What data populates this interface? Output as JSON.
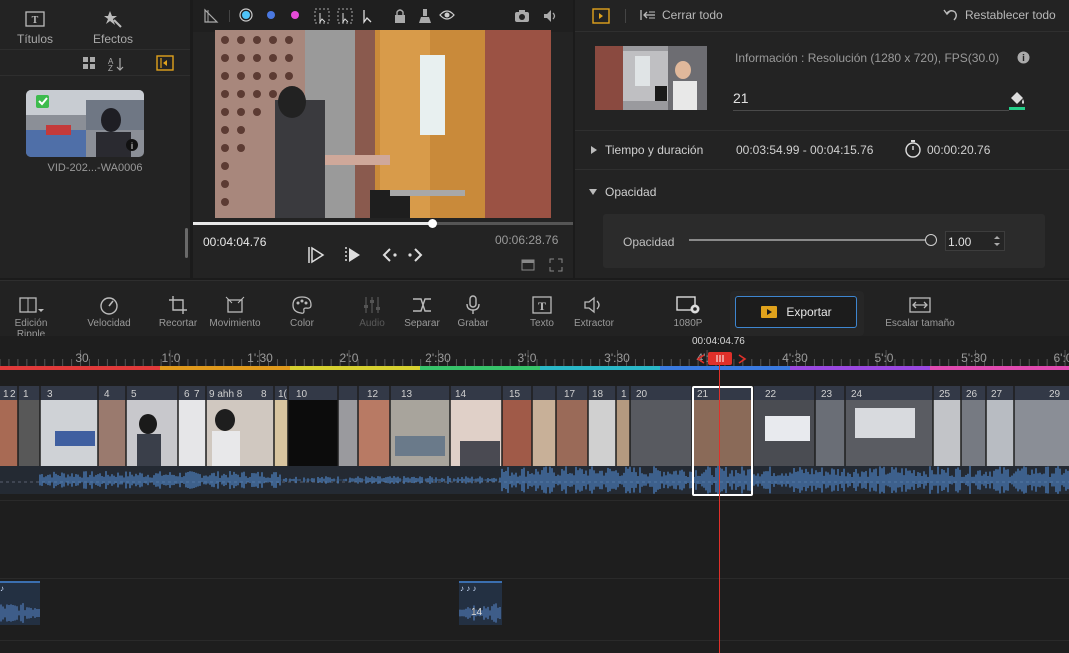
{
  "left_panel": {
    "tabs": [
      {
        "label": "Títulos",
        "icon": "titles-icon"
      },
      {
        "label": "Efectos",
        "icon": "effects-icon"
      }
    ],
    "media_item": {
      "name": "VID-202...-WA0006",
      "checked": true
    }
  },
  "preview": {
    "current_time": "00:04:04.76",
    "total_time": "00:06:28.76",
    "progress": 0.63,
    "color_dots": [
      "#4fc3f7",
      "#4a78e0",
      "#e64bd8"
    ]
  },
  "properties": {
    "close_all_label": "Cerrar todo",
    "reset_all_label": "Restablecer todo",
    "info": "Información : Resolución (1280 x 720), FPS(30.0)",
    "clip_number": "21",
    "time_section_label": "Tiempo y duración",
    "time_range": "00:03:54.99 - 00:04:15.76",
    "duration": "00:00:20.76",
    "opacity_section_label": "Opacidad",
    "opacity_label": "Opacidad",
    "opacity_value": "1.00",
    "opacity_level": 1.0
  },
  "toolbar": {
    "tools": [
      {
        "label": "Edición Ripple",
        "icon": "ripple-edit-icon"
      },
      {
        "label": "Velocidad",
        "icon": "speed-icon"
      },
      {
        "label": "Recortar",
        "icon": "crop-icon"
      },
      {
        "label": "Movimiento",
        "icon": "motion-icon"
      },
      {
        "label": "Color",
        "icon": "palette-icon"
      },
      {
        "label": "Audio",
        "icon": "audio-mixer-icon",
        "disabled": true
      },
      {
        "label": "Separar",
        "icon": "split-icon"
      },
      {
        "label": "Grabar",
        "icon": "microphone-icon"
      },
      {
        "label": "Texto",
        "icon": "text-icon"
      },
      {
        "label": "Extractor",
        "icon": "extractor-icon"
      },
      {
        "label": "1080P",
        "icon": "resolution-settings-icon"
      }
    ],
    "export_label": "Exportar",
    "scale_label": "Escalar tamaño"
  },
  "timeline": {
    "ruler_labels": [
      "30",
      "1':0",
      "1':30",
      "2':0",
      "2':30",
      "3':0",
      "3':30",
      "4':0",
      "4':30",
      "5':0",
      "5':30",
      "6':0"
    ],
    "playhead_time": "00:04:04.76",
    "clip_numbers": [
      "1",
      "2",
      "1",
      "3",
      "4",
      "5",
      "6",
      "7",
      "9 ahh 8",
      "8",
      "1(",
      "10",
      "12",
      "13",
      "14",
      "15",
      "17",
      "18",
      "1",
      "20",
      "21",
      "22",
      "23",
      "24",
      "25",
      "26",
      "27",
      "29"
    ],
    "audio_clip_label": "14"
  }
}
